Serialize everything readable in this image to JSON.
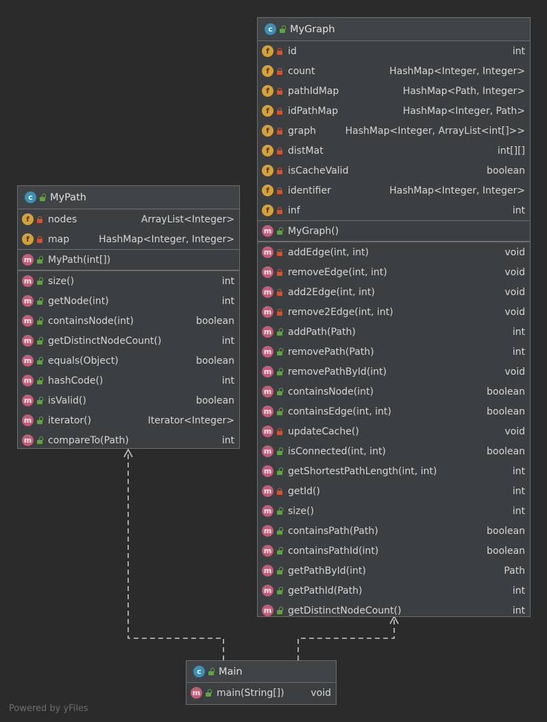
{
  "watermark": "Powered by yFiles",
  "mypath": {
    "title": "MyPath",
    "fields": [
      {
        "name": "nodes",
        "type": "ArrayList<Integer>"
      },
      {
        "name": "map",
        "type": "HashMap<Integer, Integer>"
      }
    ],
    "constructors": [
      {
        "name": "MyPath(int[])",
        "type": ""
      }
    ],
    "methods": [
      {
        "name": "size()",
        "type": "int"
      },
      {
        "name": "getNode(int)",
        "type": "int"
      },
      {
        "name": "containsNode(int)",
        "type": "boolean"
      },
      {
        "name": "getDistinctNodeCount()",
        "type": "int"
      },
      {
        "name": "equals(Object)",
        "type": "boolean"
      },
      {
        "name": "hashCode()",
        "type": "int"
      },
      {
        "name": "isValid()",
        "type": "boolean"
      },
      {
        "name": "iterator()",
        "type": "Iterator<Integer>"
      },
      {
        "name": "compareTo(Path)",
        "type": "int"
      }
    ]
  },
  "mygraph": {
    "title": "MyGraph",
    "fields": [
      {
        "name": "id",
        "type": "int"
      },
      {
        "name": "count",
        "type": "HashMap<Integer, Integer>"
      },
      {
        "name": "pathIdMap",
        "type": "HashMap<Path, Integer>"
      },
      {
        "name": "idPathMap",
        "type": "HashMap<Integer, Path>"
      },
      {
        "name": "graph",
        "type": "HashMap<Integer, ArrayList<int[]>>"
      },
      {
        "name": "distMat",
        "type": "int[][]"
      },
      {
        "name": "isCacheValid",
        "type": "boolean"
      },
      {
        "name": "identifier",
        "type": "HashMap<Integer, Integer>"
      },
      {
        "name": "inf",
        "type": "int"
      }
    ],
    "constructors": [
      {
        "name": "MyGraph()",
        "type": ""
      }
    ],
    "methods": [
      {
        "name": "addEdge(int, int)",
        "type": "void",
        "private": true
      },
      {
        "name": "removeEdge(int, int)",
        "type": "void",
        "private": true
      },
      {
        "name": "add2Edge(int, int)",
        "type": "void",
        "private": true
      },
      {
        "name": "remove2Edge(int, int)",
        "type": "void",
        "private": true
      },
      {
        "name": "addPath(Path)",
        "type": "int"
      },
      {
        "name": "removePath(Path)",
        "type": "int"
      },
      {
        "name": "removePathById(int)",
        "type": "void"
      },
      {
        "name": "containsNode(int)",
        "type": "boolean"
      },
      {
        "name": "containsEdge(int, int)",
        "type": "boolean"
      },
      {
        "name": "updateCache()",
        "type": "void",
        "private": true
      },
      {
        "name": "isConnected(int, int)",
        "type": "boolean"
      },
      {
        "name": "getShortestPathLength(int, int)",
        "type": "int"
      },
      {
        "name": "getId()",
        "type": "int",
        "private": true
      },
      {
        "name": "size()",
        "type": "int"
      },
      {
        "name": "containsPath(Path)",
        "type": "boolean"
      },
      {
        "name": "containsPathId(int)",
        "type": "boolean"
      },
      {
        "name": "getPathById(int)",
        "type": "Path"
      },
      {
        "name": "getPathId(Path)",
        "type": "int"
      },
      {
        "name": "getDistinctNodeCount()",
        "type": "int"
      }
    ]
  },
  "main": {
    "title": "Main",
    "methods": [
      {
        "name": "main(String[])",
        "type": "void"
      }
    ]
  }
}
